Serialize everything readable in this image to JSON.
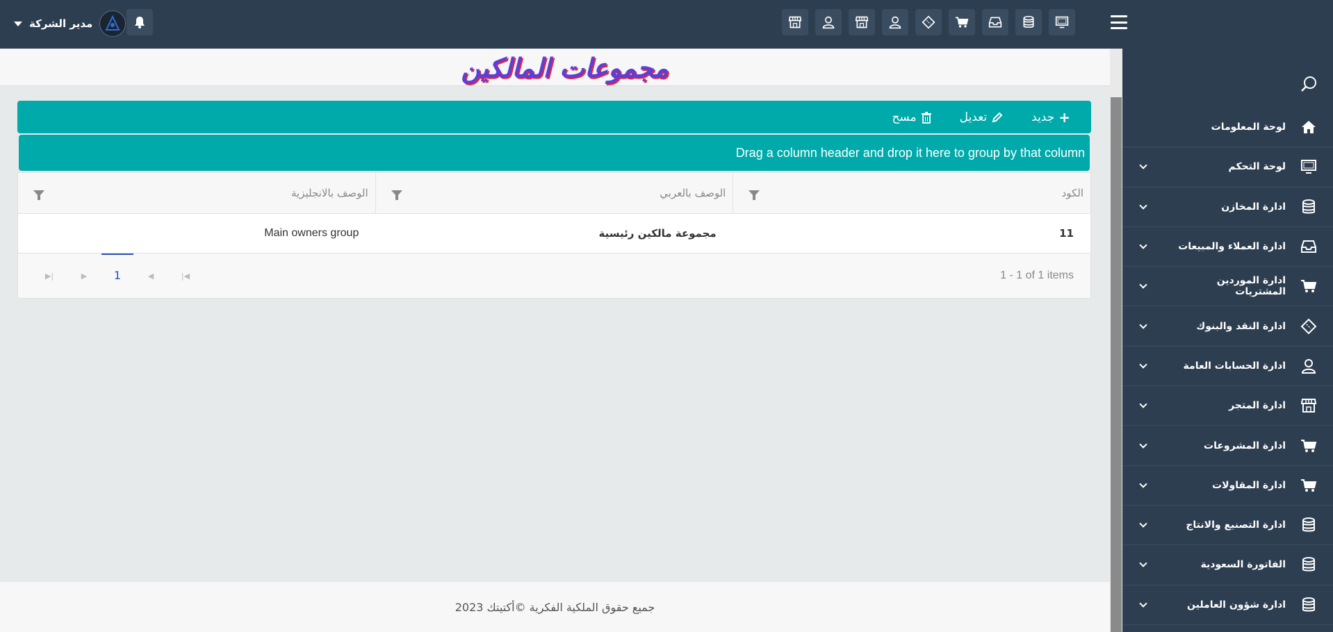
{
  "header": {
    "user_name": "مدير الشركة",
    "top_icons": [
      "monitor-icon",
      "database-icon",
      "inbox-icon",
      "cart-icon",
      "ticket-icon",
      "user-icon",
      "store-icon",
      "user-icon",
      "store-icon"
    ]
  },
  "page": {
    "title": "مجموعات المالكين"
  },
  "toolbar": {
    "new_label": "جديد",
    "edit_label": "تعديل",
    "delete_label": "مسح"
  },
  "groupbar": {
    "text": "Drag a column header and drop it here to group by that column"
  },
  "grid": {
    "columns": [
      "الكود",
      "الوصف بالعربي",
      "الوصف بالانجليزية"
    ],
    "rows": [
      {
        "code": "11",
        "desc_ar": "مجموعة مالكين رئيسية",
        "desc_en": "Main owners group"
      }
    ],
    "pager": {
      "current_page": "1",
      "info": "1 - 1 of 1 items"
    }
  },
  "footer": {
    "text": "جميع حقوق الملكية الفكرية ©أكتيتك 2023"
  },
  "sidebar": {
    "items": [
      {
        "label": "لوحة المعلومات",
        "icon": "home-icon",
        "expandable": false
      },
      {
        "label": "لوحة التحكم",
        "icon": "monitor-icon",
        "expandable": true
      },
      {
        "label": "ادارة المخازن",
        "icon": "database-icon",
        "expandable": true
      },
      {
        "label": "ادارة العملاء والمبيعات",
        "icon": "inbox-icon",
        "expandable": true
      },
      {
        "label": "ادارة الموردين المشتريات",
        "icon": "cart-icon",
        "expandable": true
      },
      {
        "label": "ادارة النقد والبنوك",
        "icon": "ticket-icon",
        "expandable": true
      },
      {
        "label": "ادارة الحسابات العامة",
        "icon": "user-icon",
        "expandable": true
      },
      {
        "label": "ادارة المتجر",
        "icon": "store-icon",
        "expandable": true
      },
      {
        "label": "ادارة المشروعات",
        "icon": "cart-icon",
        "expandable": true
      },
      {
        "label": "ادارة المقاولات",
        "icon": "cart-icon",
        "expandable": true
      },
      {
        "label": "ادارة التصنيع والانتاج",
        "icon": "database-icon",
        "expandable": true
      },
      {
        "label": "الفاتورة السعودية",
        "icon": "database-icon",
        "expandable": true
      },
      {
        "label": "ادارة شؤون العاملين",
        "icon": "database-icon",
        "expandable": true
      }
    ]
  }
}
